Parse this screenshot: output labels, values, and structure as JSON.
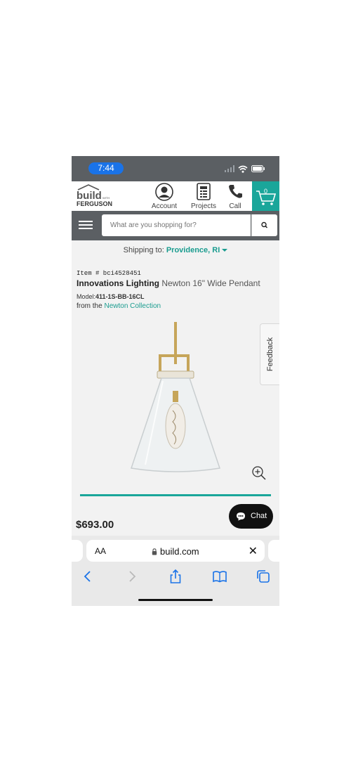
{
  "status_bar": {
    "time": "7:44"
  },
  "header": {
    "logo_line1": "build",
    "logo_with": "WITH",
    "logo_line2": "FERGUSON",
    "account_label": "Account",
    "projects_label": "Projects",
    "call_label": "Call",
    "cart_count": "0"
  },
  "search": {
    "placeholder": "What are you shopping for?"
  },
  "shipping": {
    "prefix": "Shipping to:",
    "location": "Providence, RI"
  },
  "product": {
    "item_number": "Item # bci4528451",
    "brand": "Innovations Lighting",
    "name": "Newton 16\" Wide Pendant",
    "model_prefix": "Model:",
    "model_value": "411-1S-BB-16CL",
    "collection_prefix": "from the",
    "collection_name": "Newton Collection",
    "price": "$693.00"
  },
  "feedback": {
    "label": "Feedback"
  },
  "chat": {
    "label": "Chat"
  },
  "browser": {
    "aa": "AA",
    "url": "build.com"
  },
  "colors": {
    "teal": "#1aa69a",
    "dark_gray": "#5b5f63",
    "ios_blue": "#1a73e8"
  },
  "icons": [
    "wifi-icon",
    "battery-icon",
    "account-icon",
    "projects-icon",
    "phone-icon",
    "cart-icon",
    "menu-icon",
    "search-icon",
    "zoom-in-icon",
    "chat-bubble-icon",
    "lock-icon",
    "close-icon",
    "back-icon",
    "forward-icon",
    "share-icon",
    "bookmarks-icon",
    "tabs-icon"
  ]
}
